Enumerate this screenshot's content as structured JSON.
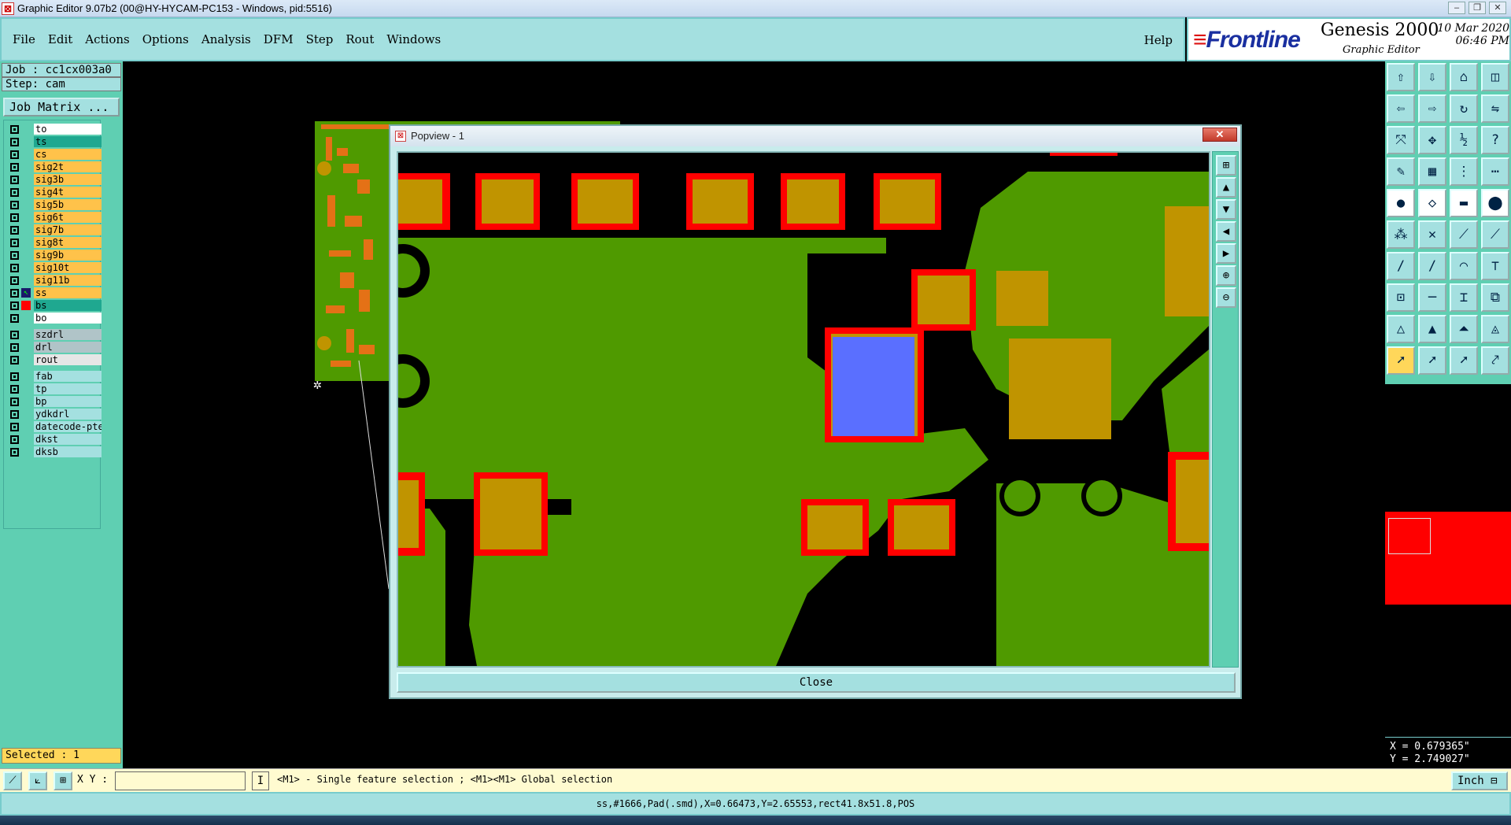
{
  "window": {
    "title": "Graphic Editor 9.07b2 (00@HY-HYCAM-PC153 - Windows, pid:5516)"
  },
  "menu": {
    "items": [
      "File",
      "Edit",
      "Actions",
      "Options",
      "Analysis",
      "DFM",
      "Step",
      "Rout",
      "Windows"
    ],
    "help": "Help"
  },
  "brand": {
    "logo": "Frontline",
    "product": "Genesis 2000",
    "subtitle": "Graphic Editor",
    "date": "10 Mar 2020",
    "time": "06:46 PM"
  },
  "job": {
    "job_label": "Job : cc1cx003a0",
    "step_label": "Step: cam",
    "matrix_button": "Job Matrix ..."
  },
  "layers": [
    {
      "name": "to",
      "color": "#ffffff",
      "marker": ""
    },
    {
      "name": "ts",
      "color": "#1fa890",
      "marker": ""
    },
    {
      "name": "cs",
      "color": "#ffc24a",
      "marker": ""
    },
    {
      "name": "sig2t",
      "color": "#ffc24a",
      "marker": ""
    },
    {
      "name": "sig3b",
      "color": "#ffc24a",
      "marker": ""
    },
    {
      "name": "sig4t",
      "color": "#ffc24a",
      "marker": ""
    },
    {
      "name": "sig5b",
      "color": "#ffc24a",
      "marker": ""
    },
    {
      "name": "sig6t",
      "color": "#ffc24a",
      "marker": ""
    },
    {
      "name": "sig7b",
      "color": "#ffc24a",
      "marker": ""
    },
    {
      "name": "sig8t",
      "color": "#ffc24a",
      "marker": ""
    },
    {
      "name": "sig9b",
      "color": "#ffc24a",
      "marker": ""
    },
    {
      "name": "sig10t",
      "color": "#ffc24a",
      "marker": ""
    },
    {
      "name": "sig11b",
      "color": "#ffc24a",
      "marker": ""
    },
    {
      "name": "ss",
      "color": "#ffc24a",
      "marker": "work"
    },
    {
      "name": "bs",
      "color": "#1fa890",
      "marker": "red"
    },
    {
      "name": "bo",
      "color": "#ffffff",
      "marker": ""
    }
  ],
  "drill_layers": [
    {
      "name": "szdrl",
      "color": "#b0c4c8"
    },
    {
      "name": "drl",
      "color": "#b0c4c8"
    },
    {
      "name": "rout",
      "color": "#e6e6e6"
    }
  ],
  "misc_layers": [
    {
      "name": "fab",
      "color": "#a4e0e0"
    },
    {
      "name": "tp",
      "color": "#a4e0e0"
    },
    {
      "name": "bp",
      "color": "#a4e0e0"
    },
    {
      "name": "ydkdrl",
      "color": "#a4e0e0"
    },
    {
      "name": "datecode-pte",
      "color": "#a4e0e0"
    },
    {
      "name": "dkst",
      "color": "#a4e0e0"
    },
    {
      "name": "dksb",
      "color": "#a4e0e0"
    }
  ],
  "selected": "Selected : 1",
  "popview": {
    "title": "Popview - 1",
    "close_label": "Close"
  },
  "coords": {
    "x": "X = 0.679365\"",
    "y": "Y = 2.749027\""
  },
  "command": {
    "xy_label": "X Y :",
    "xy_value": "",
    "prompt": "<M1> - Single feature selection ; <M1><M1> Global selection",
    "unit": "Inch"
  },
  "status": "ss,#1666,Pad(.smd),X=0.66473,Y=2.65553,rect41.8x51.8,POS",
  "colors": {
    "panel": "#5fcfb2",
    "button": "#a4e0e0",
    "copper": "#4f9a00",
    "pad": "#c09400",
    "mask": "#ff0000",
    "highlight": "#5a6fff"
  }
}
